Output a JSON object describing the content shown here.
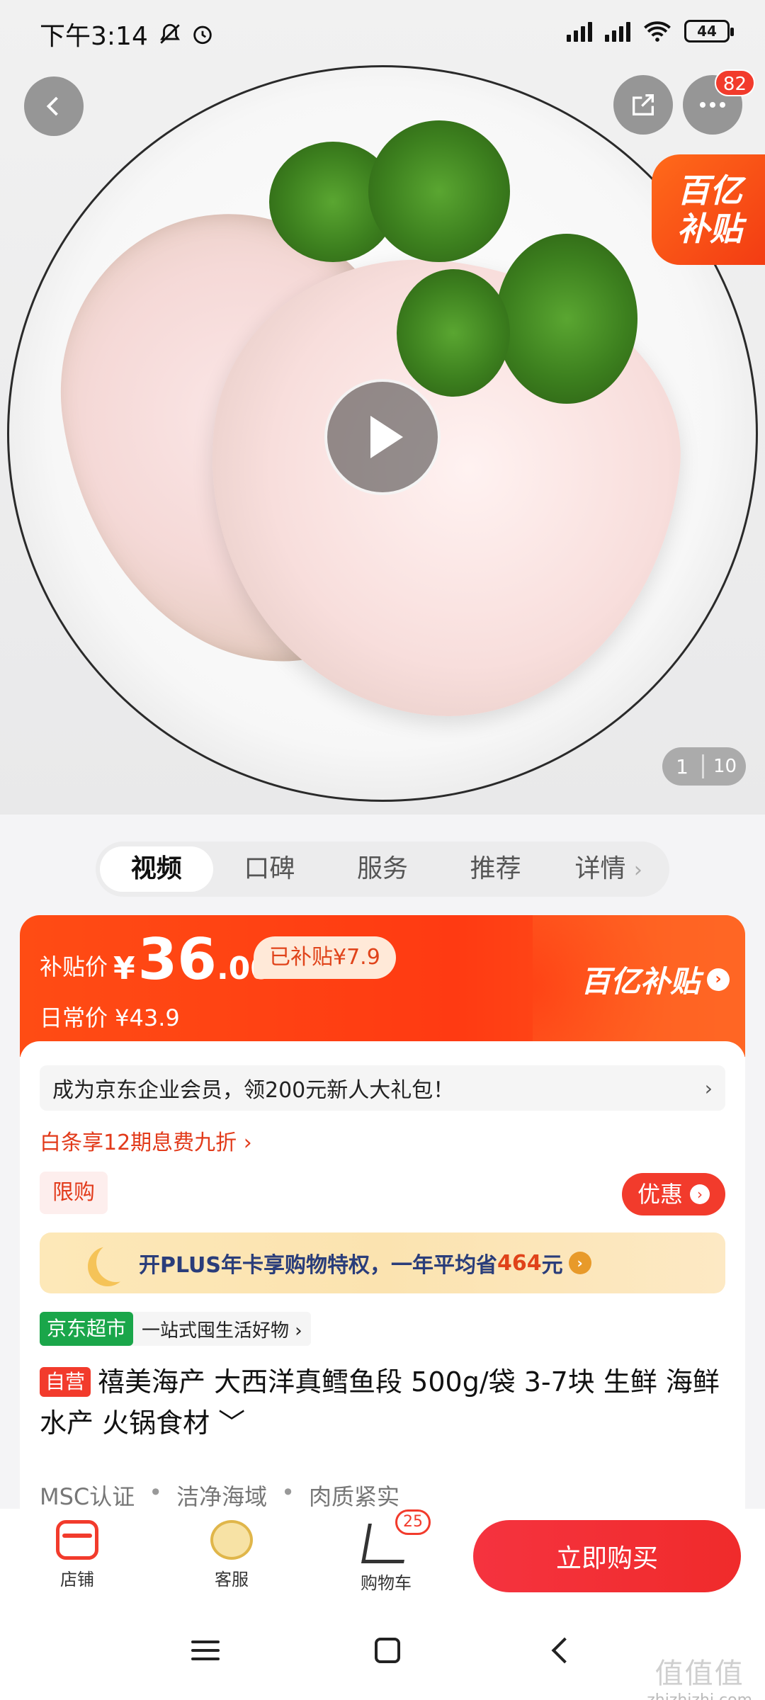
{
  "status_bar": {
    "time": "下午3:14",
    "battery": "44"
  },
  "hero": {
    "subsidy_tag_line1": "百亿",
    "subsidy_tag_line2": "补贴",
    "more_badge": "82",
    "page_current": "1",
    "page_total": "10"
  },
  "tabs": [
    {
      "label": "视频"
    },
    {
      "label": "口碑"
    },
    {
      "label": "服务"
    },
    {
      "label": "推荐"
    },
    {
      "label": "详情"
    }
  ],
  "price": {
    "label": "补贴价",
    "currency": "¥",
    "integer": "36",
    "decimal": ".00",
    "subsidized": "已补贴¥7.9",
    "daily_label": "日常价 ¥43.9",
    "logo": "百亿补贴"
  },
  "promo": {
    "member_text": "成为京东企业会员，领200元新人大礼包！",
    "baitiao": "白条享12期息费九折 ›",
    "limit_tag": "限购",
    "discount_btn": "优惠",
    "plus_text_1": "开PLUS年卡享购物特权，一年平均省",
    "plus_highlight": "464",
    "plus_text_2": "元"
  },
  "market": {
    "tag": "京东超市",
    "slogan": "一站式囤生活好物 ›"
  },
  "product": {
    "self_tag": "自营",
    "title": "禧美海产 大西洋真鳕鱼段 500g/袋 3-7块 生鲜 海鲜水产 火锅食材 ﹀",
    "certs": [
      "MSC认证",
      "洁净海域",
      "肉质紧实"
    ]
  },
  "actions": {
    "shop": "店铺",
    "service": "客服",
    "cart": "购物车",
    "cart_count": "25",
    "buy": "立即购买"
  },
  "watermark": {
    "big": "值值值",
    "small": "zhizhizhi.com"
  },
  "colors": {
    "accent_red": "#f23b2c",
    "subsidy_orange": "#ff4c14",
    "market_green": "#1aa64a"
  }
}
